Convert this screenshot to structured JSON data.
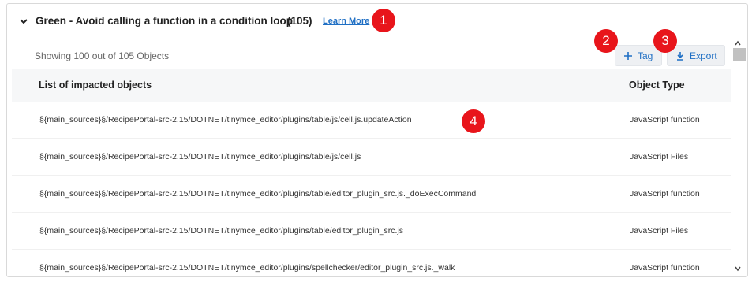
{
  "header": {
    "title": "Green - Avoid calling a function in a condition loop",
    "count": "(105)",
    "learn_more": "Learn More"
  },
  "badges": [
    "1",
    "2",
    "3",
    "4"
  ],
  "toolbar": {
    "showing": "Showing 100 out of 105 Objects",
    "tag_label": "Tag",
    "export_label": "Export"
  },
  "table": {
    "columns": [
      "List of impacted objects",
      "Object Type"
    ],
    "rows": [
      {
        "path": "§{main_sources}§/RecipePortal-src-2.15/DOTNET/tinymce_editor/plugins/table/js/cell.js.updateAction",
        "type": "JavaScript function"
      },
      {
        "path": "§{main_sources}§/RecipePortal-src-2.15/DOTNET/tinymce_editor/plugins/table/js/cell.js",
        "type": "JavaScript Files"
      },
      {
        "path": "§{main_sources}§/RecipePortal-src-2.15/DOTNET/tinymce_editor/plugins/table/editor_plugin_src.js._doExecCommand",
        "type": "JavaScript function"
      },
      {
        "path": "§{main_sources}§/RecipePortal-src-2.15/DOTNET/tinymce_editor/plugins/table/editor_plugin_src.js",
        "type": "JavaScript Files"
      },
      {
        "path": "§{main_sources}§/RecipePortal-src-2.15/DOTNET/tinymce_editor/plugins/spellchecker/editor_plugin_src.js._walk",
        "type": "JavaScript function"
      }
    ]
  },
  "icons": {
    "collapse": "chevron-down-icon",
    "tag": "plus-icon",
    "export": "download-icon",
    "scroll_up": "chevron-up-icon",
    "scroll_down": "chevron-down-icon"
  },
  "colors": {
    "accent": "#1f6fc4",
    "badge": "#e8151b"
  }
}
